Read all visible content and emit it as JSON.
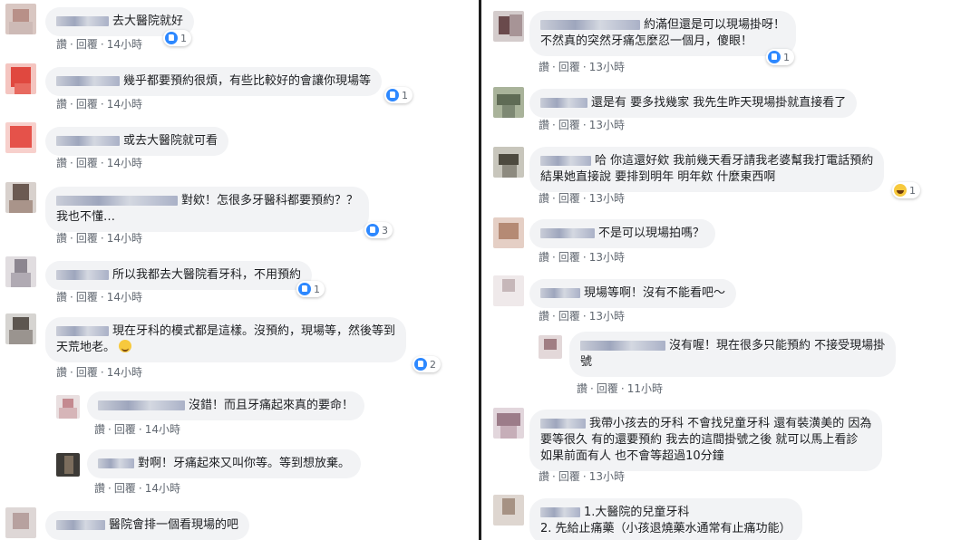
{
  "actions": {
    "like": "讚",
    "reply": "回覆",
    "dot": "·"
  },
  "left": {
    "comments": [
      {
        "text": [
          "去大醫院就好"
        ],
        "time": "14小時",
        "reactions": "1",
        "reaction_type": "like"
      },
      {
        "text": [
          "幾乎都要預約很煩，有些比較好的會讓你現場等"
        ],
        "time": "14小時",
        "reactions": "1",
        "reaction_type": "like"
      },
      {
        "text": [
          "或去大醫院就可看"
        ],
        "time": "14小時",
        "reactions": "",
        "reaction_type": ""
      },
      {
        "text": [
          "對欸！怎很多牙醫科都要預約？？",
          "我也不懂…"
        ],
        "time": "14小時",
        "reactions": "3",
        "reaction_type": "like"
      },
      {
        "text": [
          "所以我都去大醫院看牙科，不用預約"
        ],
        "time": "14小時",
        "reactions": "1",
        "reaction_type": "like"
      },
      {
        "text": [
          "現在牙科的模式都是這樣。沒預約，現場等，然後等到",
          "天荒地老。"
        ],
        "time": "14小時",
        "reactions": "2",
        "reaction_type": "like"
      },
      {
        "text": [
          "沒錯！而且牙痛起來真的要命！"
        ],
        "time": "14小時",
        "reactions": "",
        "reaction_type": ""
      },
      {
        "text": [
          "對啊！牙痛起來又叫你等。等到想放棄。"
        ],
        "time": "14小時",
        "reactions": "",
        "reaction_type": ""
      },
      {
        "text": [
          "醫院會排一個看現場的吧"
        ],
        "time": "",
        "reactions": "",
        "reaction_type": ""
      }
    ]
  },
  "right": {
    "comments": [
      {
        "text": [
          "約滿但還是可以現場掛呀！",
          "不然真的突然牙痛怎麼忍一個月，傻眼！"
        ],
        "time": "13小時",
        "reactions": "1",
        "reaction_type": "like"
      },
      {
        "text": [
          "還是有 要多找幾家 我先生昨天現場掛就直接看了"
        ],
        "time": "13小時",
        "reactions": "",
        "reaction_type": ""
      },
      {
        "text": [
          "哈 你這還好欸 我前幾天看牙請我老婆幫我打電話預約",
          "結果她直接說 要排到明年 明年欸 什麼東西啊"
        ],
        "time": "13小時",
        "reactions": "1",
        "reaction_type": "haha"
      },
      {
        "text": [
          "不是可以現場拍嗎？"
        ],
        "time": "13小時",
        "reactions": "",
        "reaction_type": ""
      },
      {
        "text": [
          "現場等啊！沒有不能看吧～"
        ],
        "time": "13小時",
        "reactions": "",
        "reaction_type": ""
      },
      {
        "text": [
          "沒有喔！現在很多只能預約 不接受現場掛",
          "號"
        ],
        "time": "11小時",
        "reactions": "",
        "reaction_type": ""
      },
      {
        "text": [
          "我帶小孩去的牙科 不會找兒童牙科 還有裝潢美的 因為",
          "要等很久 有的還要預約 我去的這間掛號之後 就可以馬上看診",
          "如果前面有人 也不會等超過10分鐘"
        ],
        "time": "13小時",
        "reactions": "",
        "reaction_type": ""
      },
      {
        "text": [
          "1.大醫院的兒童牙科",
          "2. 先給止痛藥（小孩退燒藥水通常有止痛功能）"
        ],
        "time": "",
        "reactions": "",
        "reaction_type": ""
      }
    ]
  }
}
